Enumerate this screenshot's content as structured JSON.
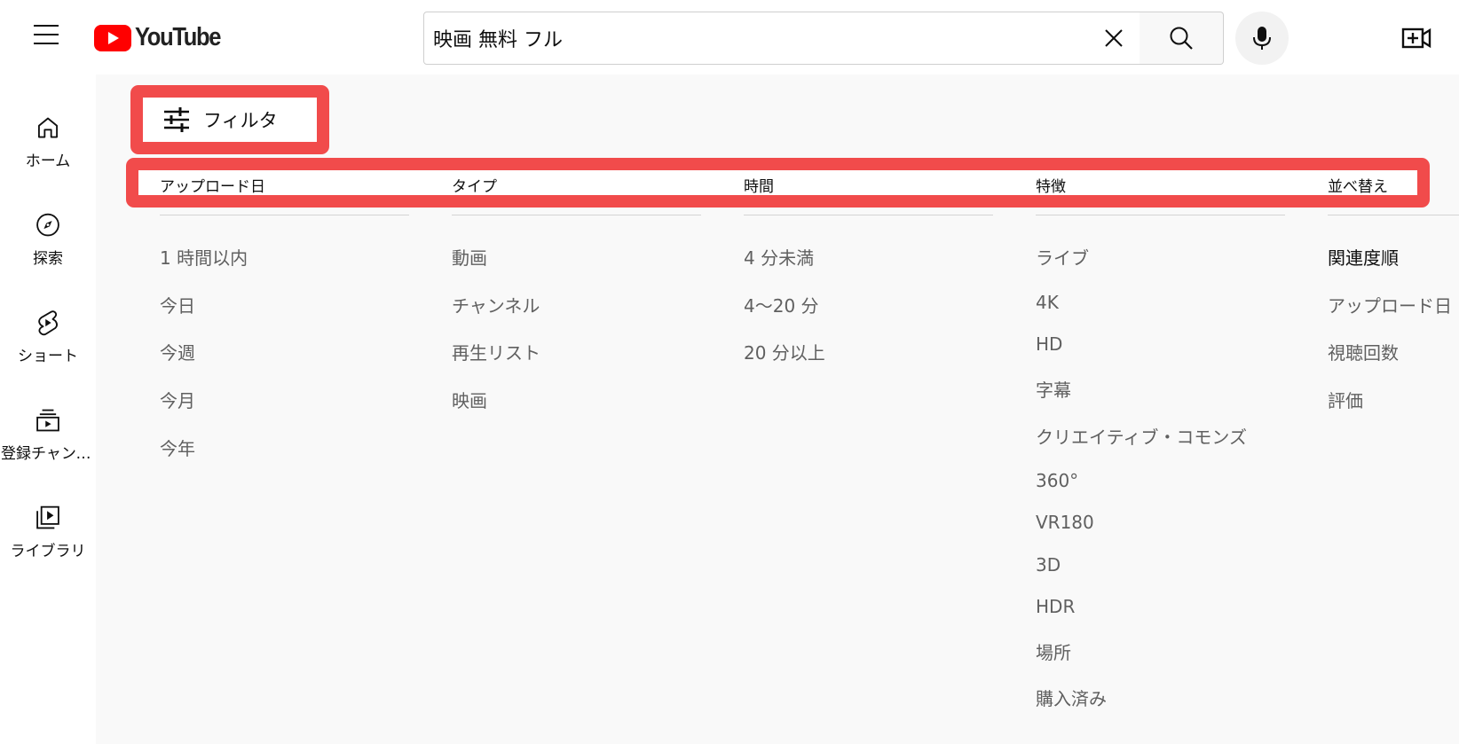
{
  "header": {
    "logo_text": "YouTube",
    "search": {
      "value": "映画 無料 フル",
      "placeholder": "検索"
    }
  },
  "sidebar": {
    "items": [
      {
        "label": "ホーム",
        "icon": "home-icon"
      },
      {
        "label": "探索",
        "icon": "compass-icon"
      },
      {
        "label": "ショート",
        "icon": "shorts-icon"
      },
      {
        "label": "登録チャンネル",
        "icon": "subscriptions-icon"
      },
      {
        "label": "ライブラリ",
        "icon": "library-icon"
      }
    ]
  },
  "filter": {
    "label": "フィルタ"
  },
  "columns": [
    {
      "heading": "アップロード日",
      "options": [
        "1 時間以内",
        "今日",
        "今週",
        "今月",
        "今年"
      ]
    },
    {
      "heading": "タイプ",
      "options": [
        "動画",
        "チャンネル",
        "再生リスト",
        "映画"
      ]
    },
    {
      "heading": "時間",
      "options": [
        "4 分未満",
        "4～20 分",
        "20 分以上"
      ]
    },
    {
      "heading": "特徴",
      "options": [
        "ライブ",
        "4K",
        "HD",
        "字幕",
        "クリエイティブ・コモンズ",
        "360°",
        "VR180",
        "3D",
        "HDR",
        "場所",
        "購入済み"
      ]
    },
    {
      "heading": "並べ替え",
      "options": [
        "関連度順",
        "アップロード日",
        "視聴回数",
        "評価"
      ]
    }
  ],
  "colors": {
    "brand_red": "#ff0000",
    "annotation_red": "#f14b4b",
    "panel_bg": "#f9f9f9",
    "option_text": "#606060"
  }
}
